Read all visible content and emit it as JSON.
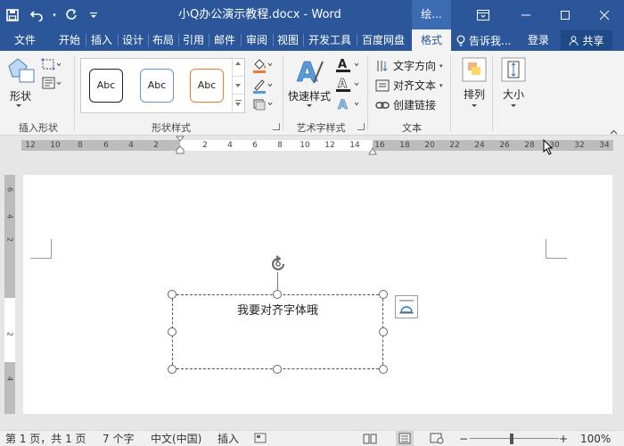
{
  "titlebar": {
    "document_title": "小Q办公演示教程.docx - Word",
    "context_tab_title": "绘...",
    "save_icon": "save-icon",
    "undo_icon": "undo-icon",
    "redo_icon": "redo-icon",
    "customize_icon": "customize-qat-icon"
  },
  "tabs": [
    {
      "label": "文件"
    },
    {
      "label": "开始"
    },
    {
      "label": "插入"
    },
    {
      "label": "设计"
    },
    {
      "label": "布局"
    },
    {
      "label": "引用"
    },
    {
      "label": "邮件"
    },
    {
      "label": "审阅"
    },
    {
      "label": "视图"
    },
    {
      "label": "开发工具"
    },
    {
      "label": "百度网盘"
    },
    {
      "label": "格式",
      "active": true
    }
  ],
  "tellme": "告诉我...",
  "signin": "登录",
  "share": "共享",
  "ribbon": {
    "insert_shapes": {
      "shapes_label": "形状",
      "group_label": "插入形状"
    },
    "shape_styles": {
      "samples": [
        "Abc",
        "Abc",
        "Abc"
      ],
      "sample_colors": [
        "#222222",
        "#5b9bd5",
        "#ed7d31"
      ],
      "group_label": "形状样式"
    },
    "wordart": {
      "quick_styles_label": "快速样式",
      "group_label": "艺术字样式"
    },
    "text": {
      "direction": "文字方向",
      "align": "对齐文本",
      "link": "创建链接",
      "group_label": "文本"
    },
    "arrange": {
      "label": "排列"
    },
    "size": {
      "label": "大小"
    }
  },
  "ruler": {
    "numbers": [
      "12",
      "10",
      "8",
      "6",
      "4",
      "2",
      "",
      "2",
      "4",
      "6",
      "8",
      "10",
      "12",
      "14",
      "16",
      "18",
      "20",
      "22",
      "24",
      "26",
      "28",
      "30",
      "32",
      "34"
    ]
  },
  "vruler": {
    "numbers": [
      "6",
      "4",
      "2",
      "",
      "2",
      "4"
    ]
  },
  "document": {
    "textbox_text": "我要对齐字体哦"
  },
  "status": {
    "page": "第 1 页，共 1 页",
    "words": "7 个字",
    "language": "中文(中国)",
    "mode": "插入",
    "zoom": "100%",
    "zoom_level": 1.0
  },
  "colors": {
    "brand": "#2b579a",
    "ribbon_bg": "#f3f3f3"
  }
}
